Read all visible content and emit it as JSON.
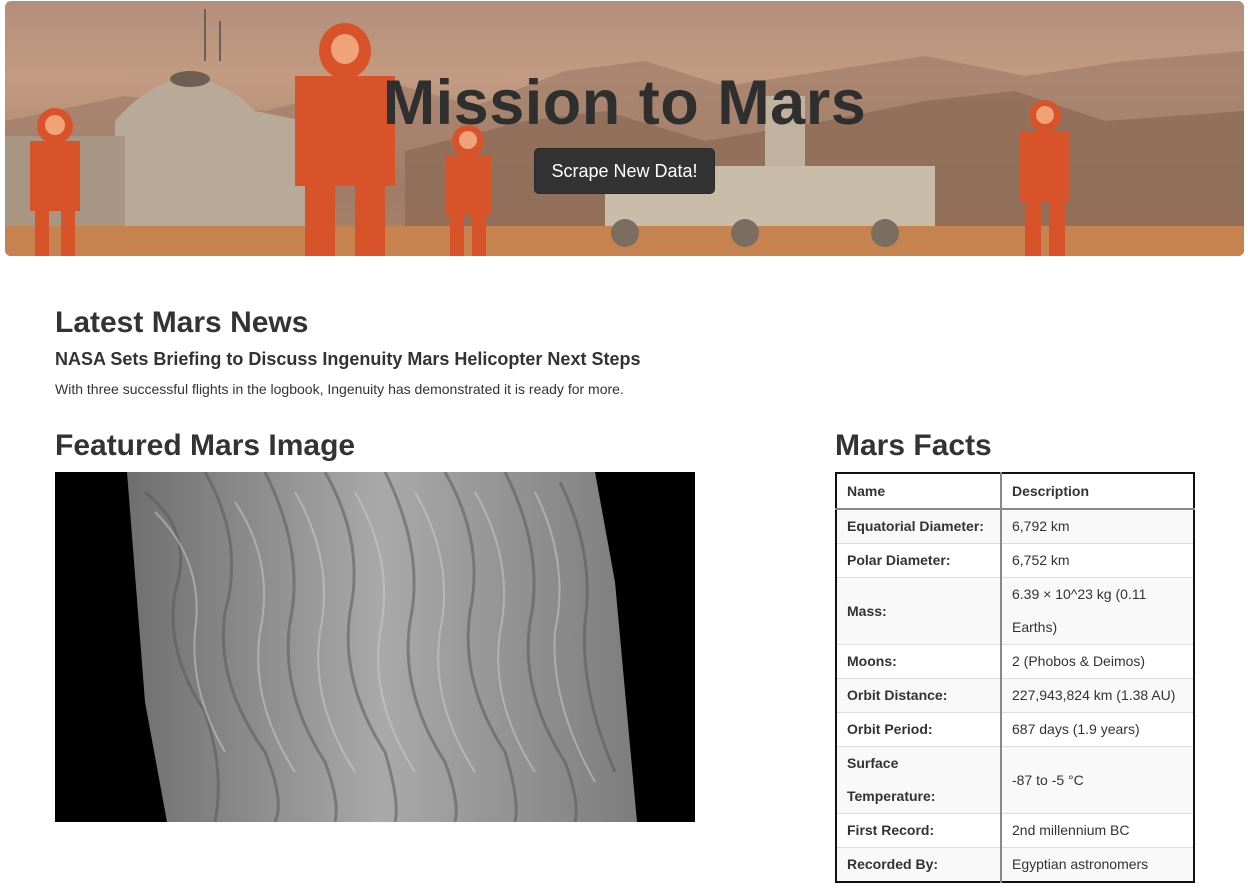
{
  "header": {
    "title": "Mission to Mars",
    "scrape_button": "Scrape New Data!"
  },
  "news": {
    "heading": "Latest Mars News",
    "title": "NASA Sets Briefing to Discuss Ingenuity Mars Helicopter Next Steps",
    "paragraph": "With three successful flights in the logbook, Ingenuity has demonstrated it is ready for more."
  },
  "featured_image": {
    "heading": "Featured Mars Image"
  },
  "facts": {
    "heading": "Mars Facts",
    "columns": [
      "Name",
      "Description"
    ],
    "rows": [
      {
        "name": "Equatorial Diameter:",
        "value": "6,792 km"
      },
      {
        "name": "Polar Diameter:",
        "value": "6,752 km"
      },
      {
        "name": "Mass:",
        "value": "6.39 × 10^23 kg (0.11 Earths)"
      },
      {
        "name": "Moons:",
        "value": "2 (Phobos & Deimos)"
      },
      {
        "name": "Orbit Distance:",
        "value": "227,943,824 km (1.38 AU)"
      },
      {
        "name": "Orbit Period:",
        "value": "687 days (1.9 years)"
      },
      {
        "name": "Surface Temperature:",
        "value": "-87 to -5 °C"
      },
      {
        "name": "First Record:",
        "value": "2nd millennium BC"
      },
      {
        "name": "Recorded By:",
        "value": "Egyptian astronomers"
      }
    ]
  }
}
